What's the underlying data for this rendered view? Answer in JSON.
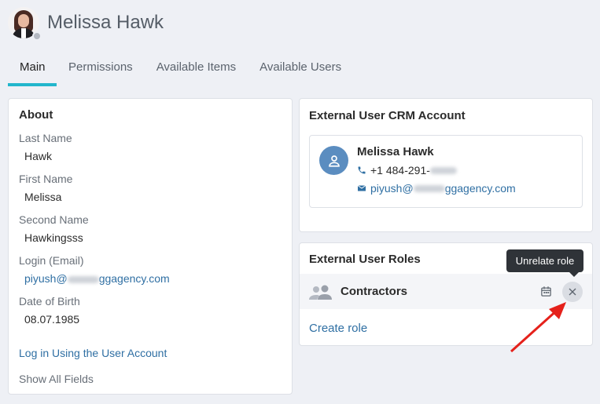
{
  "user": {
    "name": "Melissa Hawk"
  },
  "tabs": [
    {
      "label": "Main",
      "active": true
    },
    {
      "label": "Permissions"
    },
    {
      "label": "Available Items"
    },
    {
      "label": "Available Users"
    }
  ],
  "about": {
    "title": "About",
    "fields": [
      {
        "label": "Last Name",
        "value": "Hawk"
      },
      {
        "label": "First Name",
        "value": "Melissa"
      },
      {
        "label": "Second Name",
        "value": "Hawkingsss"
      },
      {
        "label": "Login (Email)",
        "value_prefix": "piyush@",
        "value_suffix": "ggagency.com"
      },
      {
        "label": "Date of Birth",
        "value": "08.07.1985"
      }
    ],
    "login_link": "Log in Using the User Account",
    "show_all": "Show All Fields"
  },
  "crm": {
    "title": "External User CRM Account",
    "contact_name": "Melissa Hawk",
    "phone_prefix": "+1 484-291-",
    "email_prefix": "piyush@",
    "email_suffix": "ggagency.com"
  },
  "roles": {
    "title": "External User Roles",
    "items": [
      {
        "name": "Contractors"
      }
    ],
    "create_label": "Create role"
  },
  "tooltip": {
    "text": "Unrelate role"
  },
  "colors": {
    "accent": "#22b6cc",
    "link": "#2f6fa3",
    "annotation_arrow": "#e5211b"
  }
}
